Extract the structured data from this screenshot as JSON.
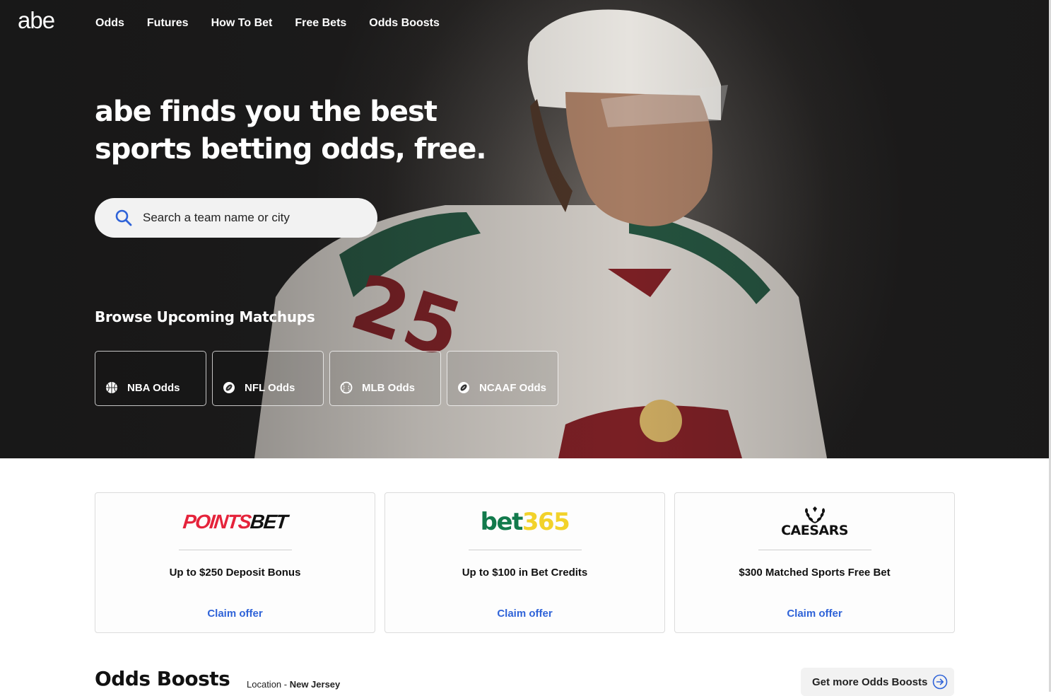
{
  "brand": {
    "logo_text": "abe"
  },
  "nav": {
    "items": [
      {
        "label": "Odds"
      },
      {
        "label": "Futures"
      },
      {
        "label": "How To Bet"
      },
      {
        "label": "Free Bets"
      },
      {
        "label": "Odds Boosts"
      }
    ]
  },
  "hero": {
    "title_line1": "abe finds you the best",
    "title_line2": "sports betting odds, free.",
    "search": {
      "placeholder": "Search a team name or city",
      "icon": "search-icon"
    },
    "browse_title": "Browse Upcoming Matchups",
    "sports": [
      {
        "label": "NBA Odds",
        "icon": "basketball-icon"
      },
      {
        "label": "NFL Odds",
        "icon": "football-icon"
      },
      {
        "label": "MLB Odds",
        "icon": "baseball-icon"
      },
      {
        "label": "NCAAF Odds",
        "icon": "football-icon"
      }
    ]
  },
  "offers": [
    {
      "brand": "POINTSBET",
      "brand_part1": "POINTS",
      "brand_part2": "BET",
      "title": "Up to $250 Deposit Bonus",
      "cta": "Claim offer",
      "brand_colors": [
        "#e5233b",
        "#111111"
      ]
    },
    {
      "brand": "bet365",
      "brand_part1": "bet",
      "brand_part2": "365",
      "title": "Up to $100 in Bet Credits",
      "cta": "Claim offer",
      "brand_colors": [
        "#127a4c",
        "#f2d22a"
      ]
    },
    {
      "brand": "CAESARS",
      "title": "$300 Matched Sports Free Bet",
      "cta": "Claim offer"
    }
  ],
  "odds_boosts": {
    "title": "Odds Boosts",
    "location_label": "Location - ",
    "location_value": "New Jersey",
    "more_label": "Get more Odds Boosts"
  },
  "colors": {
    "accent": "#2f63d8",
    "hero_text": "#ffffff"
  }
}
